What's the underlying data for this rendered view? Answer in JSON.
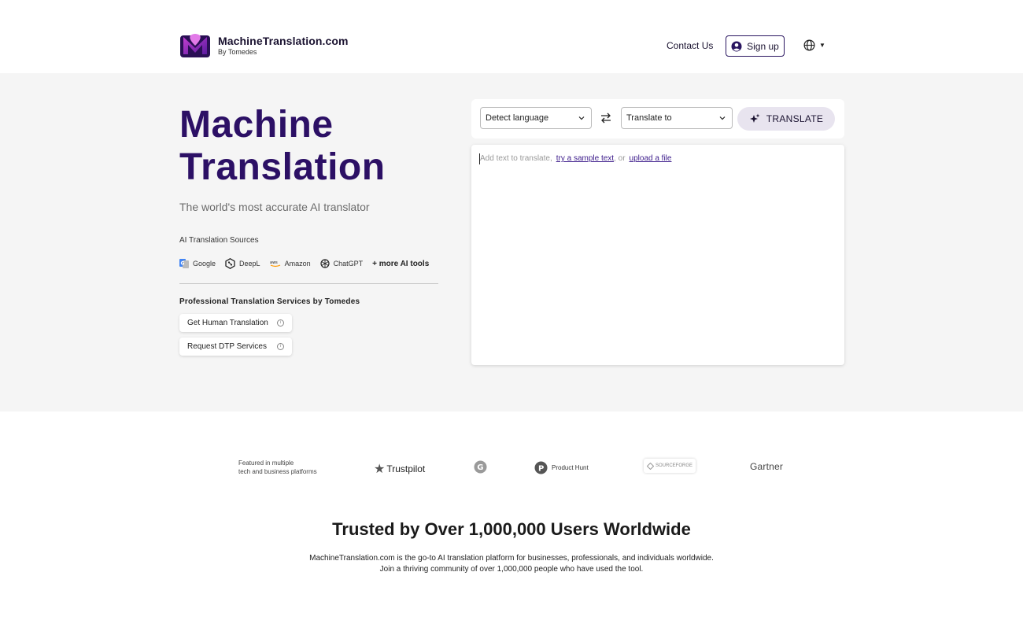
{
  "header": {
    "logo_title": "MachineTranslation.com",
    "logo_sub": "By Tomedes",
    "contact": "Contact Us",
    "signup": "Sign up",
    "lang_icon": "globe-icon"
  },
  "hero": {
    "title_line1": "Machine",
    "title_line2": "Translation",
    "subtitle": "The world's most accurate AI translator",
    "sources_label": "AI Translation Sources",
    "sources": [
      "Google",
      "DeepL",
      "Amazon",
      "ChatGPT"
    ],
    "more_tools": "+ more AI tools",
    "pro_label": "Professional Translation Services by Tomedes",
    "pro_buttons": [
      "Get Human Translation",
      "Request DTP Services"
    ]
  },
  "translator": {
    "source_lang": "Detect language",
    "target_lang": "Translate to",
    "translate_label": "TRANSLATE",
    "placeholder_prefix": "Add text to translate,",
    "sample_link": "try a sample text",
    "or_text": ", or",
    "upload_link": "upload a file"
  },
  "featured": {
    "label_line1": "Featured in multiple",
    "label_line2": "tech and business platforms",
    "platforms": [
      "Trustpilot",
      "Product Hunt",
      "SOURCEFORGE",
      "Gartner"
    ]
  },
  "trusted": {
    "title": "Trusted by Over 1,000,000 Users Worldwide",
    "desc_line1": "MachineTranslation.com is the go-to AI translation platform for businesses, professionals, and individuals worldwide.",
    "desc_line2": "Join a thriving community of over 1,000,000 people who have used the tool."
  },
  "colors": {
    "brand_purple": "#2c1065",
    "hero_bg": "#f5f5f5",
    "translate_btn_bg": "#e8e4ef"
  }
}
